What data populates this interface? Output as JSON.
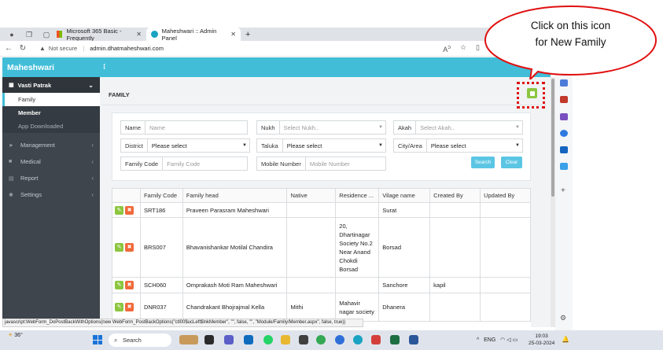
{
  "browser": {
    "tabs": [
      {
        "label": "Microsoft 365 Basic - Frequently"
      },
      {
        "label": "Maheshwari :: Admin Panel"
      }
    ],
    "new_tab_symbol": "+",
    "not_secure": "Not secure",
    "url": "admin.dhatmaheshwari.com"
  },
  "app": {
    "brand": "Maheshwari",
    "header_menu_symbol": "⁝"
  },
  "sidebar": {
    "group": {
      "label": "Vasti Patrak"
    },
    "subitems": [
      {
        "label": "Family"
      },
      {
        "label": "Member"
      },
      {
        "label": "App Downloaded"
      }
    ],
    "items": [
      {
        "label": "Management"
      },
      {
        "label": "Medical"
      },
      {
        "label": "Report"
      },
      {
        "label": "Settings"
      }
    ]
  },
  "page": {
    "title": "FAMILY"
  },
  "filters": {
    "name": {
      "label": "Name",
      "placeholder": "Name"
    },
    "nukh": {
      "label": "Nukh",
      "placeholder": "Select Nukh.."
    },
    "akah": {
      "label": "Akah",
      "placeholder": "Select Akah.."
    },
    "district": {
      "label": "District",
      "value": "Please select"
    },
    "taluka": {
      "label": "Taluka",
      "value": "Please select"
    },
    "city": {
      "label": "City/Area",
      "value": "Please select"
    },
    "family_code": {
      "label": "Family Code",
      "placeholder": "Family Code"
    },
    "mobile": {
      "label": "Mobile Number",
      "placeholder": "Mobile Number"
    },
    "search_label": "Search",
    "clear_label": "Clear"
  },
  "table": {
    "columns": [
      "Family Code",
      "Family head",
      "Native",
      "Residence ...",
      "Vilage name",
      "Created By",
      "Updated By"
    ],
    "rows": [
      {
        "code": "SRT186",
        "head": "Praveen Parasram Maheshwari",
        "native": "",
        "residence": "",
        "village": "Surat",
        "created": "",
        "updated": ""
      },
      {
        "code": "BRS007",
        "head": "Bhavanishankar Motilal Chandira",
        "native": "",
        "residence": "20, Dhartinagar Society No.2 Near Anand Chokdi Borsad",
        "village": "Borsad",
        "created": "",
        "updated": ""
      },
      {
        "code": "SCH060",
        "head": "Omprakash Moti Ram Maheshwari",
        "native": "",
        "residence": "",
        "village": "Sanchore",
        "created": "kapil",
        "updated": ""
      },
      {
        "code": "DNR037",
        "head": "Chandrakant Bhojrajmal Kella",
        "native": "Mithi",
        "residence": "Mahavir nagar society",
        "village": "Dhanera",
        "created": "",
        "updated": ""
      }
    ]
  },
  "status_bar": "javascript:WebForm_DoPostBackWithOptions(new WebForm_PostBackOptions(\"ctl00$ucLeft$lnkMember\", \"\", false, \"\", \"Module/Family/Member.aspx\", false, true))",
  "callout": {
    "line1": "Click on this icon",
    "line2": "for New Family"
  },
  "taskbar": {
    "weather": "36°",
    "search": "Search",
    "lang": "ENG",
    "time": "19:03",
    "date": "25-03-2024"
  },
  "colors": {
    "accent": "#41bdd8",
    "sidebar": "#3e454d",
    "add_button": "#8cc63f",
    "delete_button": "#f06a3a",
    "highlight": "#e01010"
  }
}
